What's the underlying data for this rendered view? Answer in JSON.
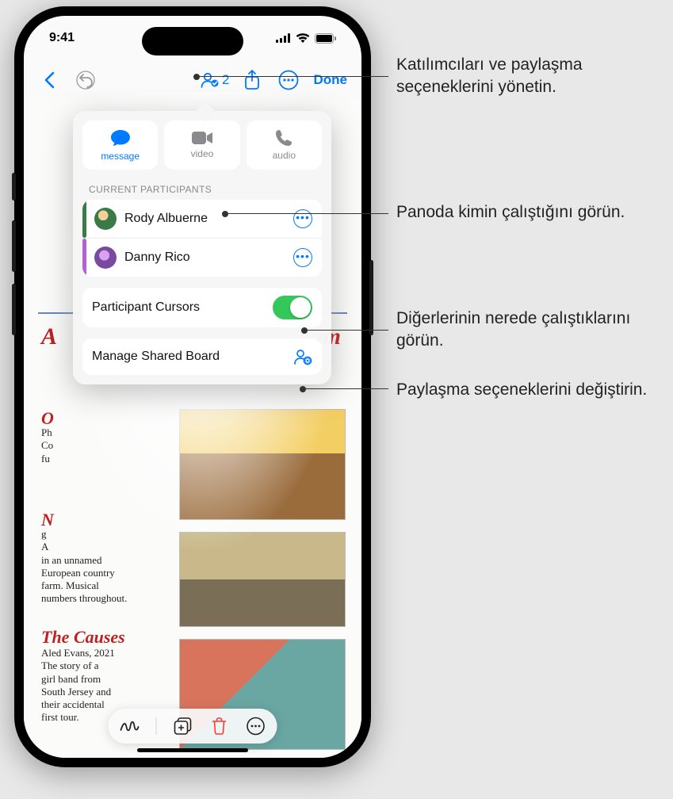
{
  "status": {
    "time": "9:41"
  },
  "toolbar": {
    "collab_count": "2",
    "done": "Done"
  },
  "popover": {
    "contact_tiles": [
      {
        "label": "message",
        "icon": "message-icon",
        "active": true
      },
      {
        "label": "video",
        "icon": "video-icon",
        "active": false
      },
      {
        "label": "audio",
        "icon": "phone-icon",
        "active": false
      }
    ],
    "section_label": "CURRENT PARTICIPANTS",
    "participants": [
      {
        "name": "Rody Albuerne"
      },
      {
        "name": "Danny Rico"
      }
    ],
    "cursors_label": "Participant Cursors",
    "cursors_on": true,
    "manage_label": "Manage Shared Board"
  },
  "canvas": {
    "title_left": "A",
    "title_right": "eam",
    "h1": "O",
    "b1": "Ph\nCo\nfu",
    "h2": "N",
    "b2": "g\nA\nin an unnamed\nEuropean country\nfarm. Musical\nnumbers throughout.",
    "h3": "The Causes",
    "b3": "Aled Evans, 2021\nThe story of a\ngirl band from\nSouth Jersey and\ntheir accidental\nfirst tour."
  },
  "callouts": {
    "c1": "Katılımcıları ve paylaşma seçeneklerini yönetin.",
    "c2": "Panoda kimin çalıştığını görün.",
    "c3": "Diğerlerinin nerede çalıştıklarını görün.",
    "c4": "Paylaşma seçeneklerini değiştirin."
  }
}
